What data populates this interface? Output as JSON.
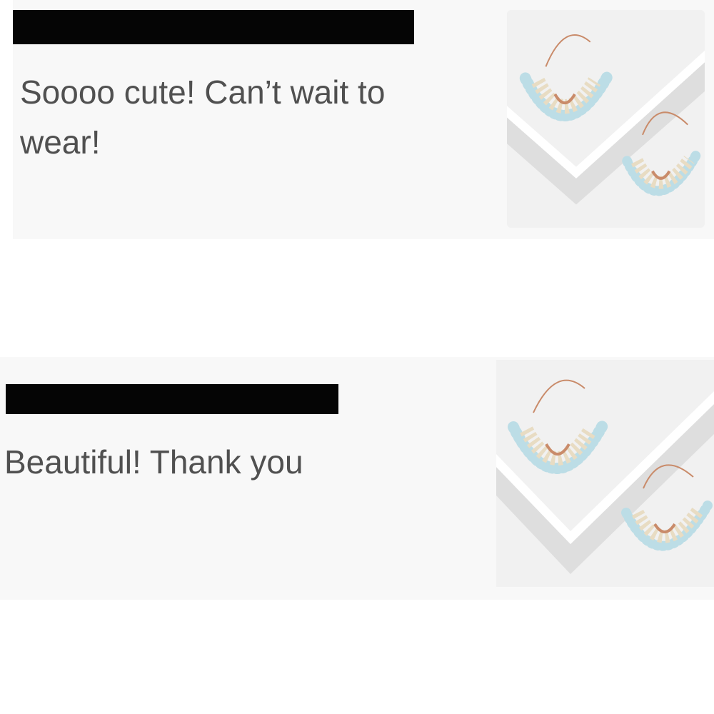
{
  "reviews": [
    {
      "text": "Soooo cute! Can’t wait to wear!",
      "thumbnail_icon": "earrings-image",
      "name_redacted": true
    },
    {
      "text": "Beautiful! Thank you",
      "thumbnail_icon": "earrings-image",
      "name_redacted": true
    }
  ],
  "colors": {
    "card_background": "#f8f8f8",
    "text": "#505050",
    "redaction": "#050505"
  }
}
